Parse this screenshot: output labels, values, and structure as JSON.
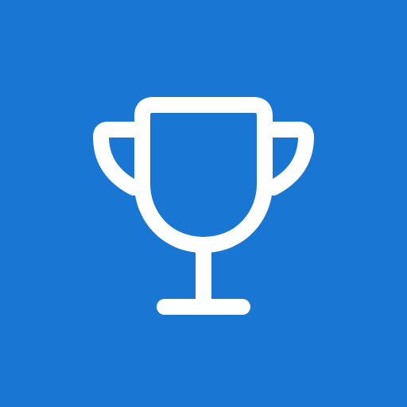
{
  "app_icon": {
    "icon": "trophy-icon",
    "background_color": "#1976D2",
    "foreground_color": "#FFFFFF"
  }
}
